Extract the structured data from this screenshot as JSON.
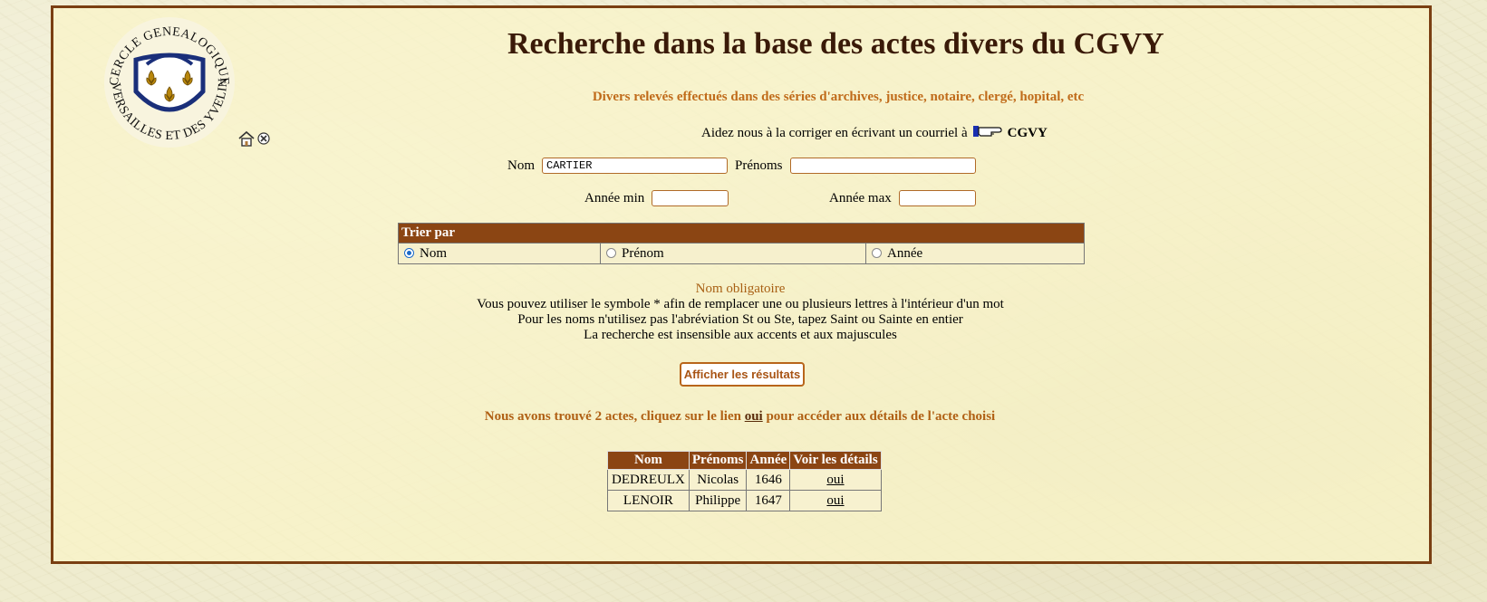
{
  "header": {
    "title": "Recherche dans la base des actes divers du CGVY",
    "subtitle": "Divers relevés effectués dans des séries d'archives, justice, notaire, clergé, hopital, etc",
    "contact_text": "Aidez nous à la corriger en écrivant un courriel à",
    "contact_name": "CGVY"
  },
  "logo": {
    "arc_top": "CERCLE GENEALOGIQUE",
    "arc_bottom": "DE VERSAILLES ET DES YVELINES"
  },
  "icons": [
    "home-icon",
    "close-icon",
    "pointing-hand-icon"
  ],
  "form": {
    "nom_label": "Nom",
    "nom_value": "CARTIER",
    "prenoms_label": "Prénoms",
    "prenoms_value": "",
    "annee_min_label": "Année min",
    "annee_min_value": "",
    "annee_max_label": "Année max",
    "annee_max_value": ""
  },
  "sort": {
    "header": "Trier par",
    "options": [
      "Nom",
      "Prénom",
      "Année"
    ],
    "selected": "Nom"
  },
  "info": {
    "required": "Nom obligatoire",
    "lines": [
      "Vous pouvez utiliser le symbole * afin de remplacer une ou plusieurs lettres à l'intérieur d'un mot",
      "Pour les noms n'utilisez pas l'abréviation St ou Ste, tapez Saint ou Sainte en entier",
      "La recherche est insensible aux accents et aux majuscules"
    ]
  },
  "submit_label": "Afficher les résultats",
  "result_message": {
    "before": "Nous avons trouvé 2 actes, cliquez sur le lien ",
    "link": "oui",
    "after": " pour accéder aux détails de l'acte choisi"
  },
  "results": {
    "columns": [
      "Nom",
      "Prénoms",
      "Année",
      "Voir les détails"
    ],
    "rows": [
      {
        "nom": "DEDREULX",
        "prenoms": "Nicolas",
        "annee": "1646",
        "details": "oui"
      },
      {
        "nom": "LENOIR",
        "prenoms": "Philippe",
        "annee": "1647",
        "details": "oui"
      }
    ]
  },
  "colors": {
    "accent_brown": "#8b4513",
    "title_color": "#3a1a08",
    "orange_text": "#c06b1a",
    "frame_border": "#7a3f12"
  }
}
